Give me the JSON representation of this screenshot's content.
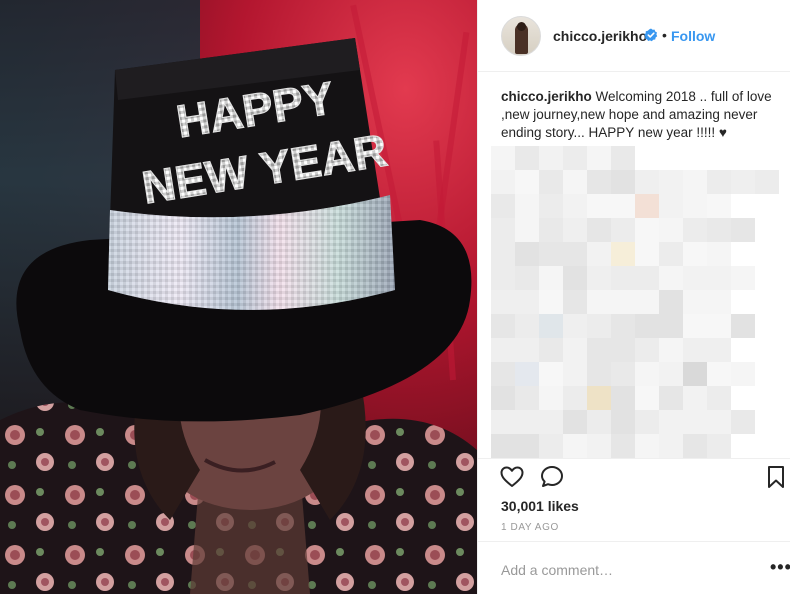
{
  "post": {
    "username": "chicco.jerikho",
    "verified": true,
    "follow_label": "Follow",
    "separator": "•",
    "caption_user": "chicco.jerikho",
    "caption_text": " Welcoming 2018 .. full of love ,new journey,new hope and amazing never ending story... HAPPY new year !!!!! ♥",
    "likes": "30,001 likes",
    "date": "1 DAY AGO",
    "comment_placeholder": "Add a comment…",
    "more_label": "•••",
    "photo_hat_text": [
      "HAPPY",
      "NEW YEAR"
    ]
  },
  "icons": {
    "like": "heart-icon",
    "comment": "comment-bubble-icon",
    "save": "bookmark-icon",
    "verified": "verified-badge-icon",
    "more": "more-options-icon"
  },
  "colors": {
    "link_blue": "#3897f0",
    "text": "#262626",
    "muted": "#999999",
    "border": "#efefef"
  }
}
